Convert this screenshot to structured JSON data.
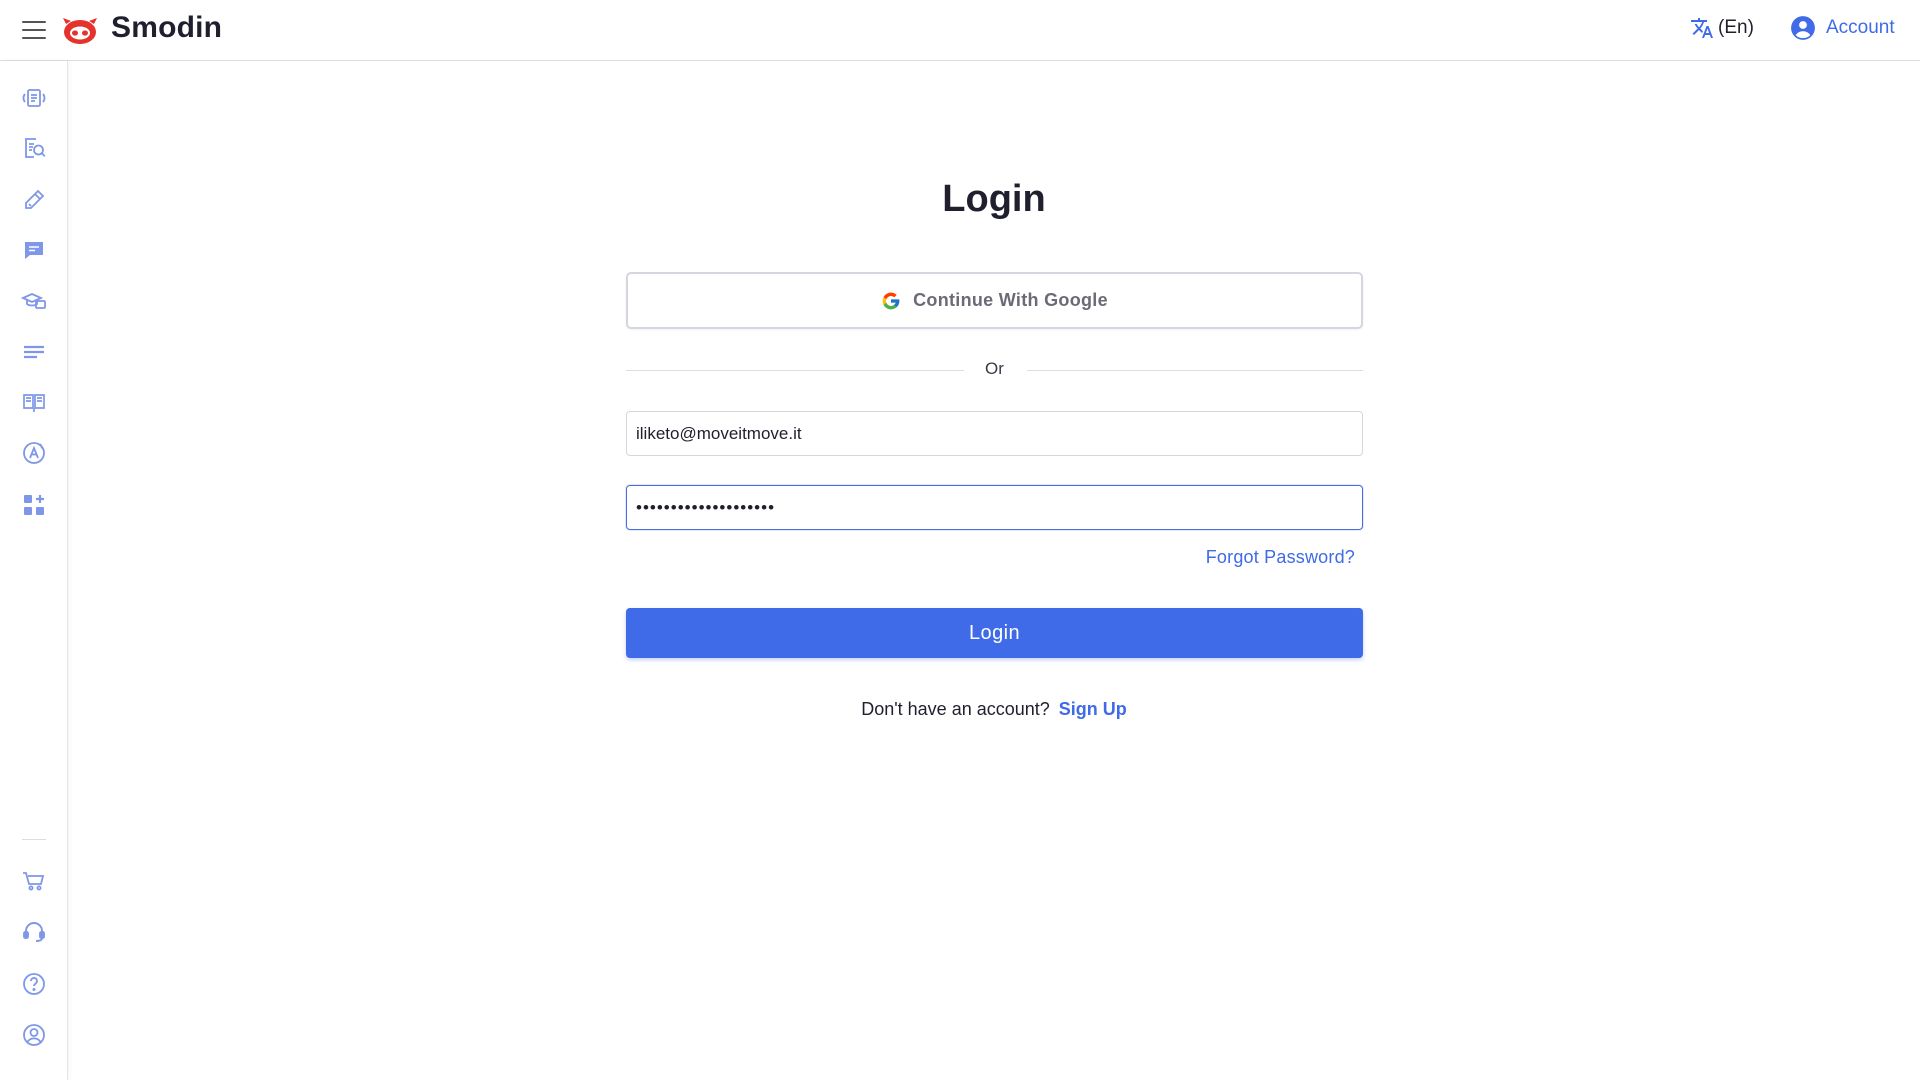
{
  "header": {
    "brand": "Smodin",
    "language": "(En)",
    "account": "Account"
  },
  "sidebar": {
    "top_items": [
      {
        "icon": "rewriter-icon"
      },
      {
        "icon": "plagiarism-checker-icon"
      },
      {
        "icon": "writer-icon"
      },
      {
        "icon": "chat-icon"
      },
      {
        "icon": "homework-solver-icon"
      },
      {
        "icon": "summarizer-icon"
      },
      {
        "icon": "citation-icon"
      },
      {
        "icon": "ai-detector-icon"
      },
      {
        "icon": "more-apps-icon"
      }
    ],
    "bottom_items": [
      {
        "icon": "cart-icon"
      },
      {
        "icon": "support-icon"
      },
      {
        "icon": "help-icon"
      },
      {
        "icon": "account-icon"
      }
    ]
  },
  "login": {
    "title": "Login",
    "google_button": "Continue With Google",
    "divider": "Or",
    "email_value": "iliketo@moveitmove.it",
    "password_value": "••••••••••••••••••••",
    "forgot_password": "Forgot Password?",
    "submit": "Login",
    "signup_prompt": "Don't have an account?",
    "signup_link": "Sign Up"
  },
  "colors": {
    "accent": "#3f6ae8",
    "brand_red": "#e5322d",
    "icon_tint": "#7f97e8"
  }
}
